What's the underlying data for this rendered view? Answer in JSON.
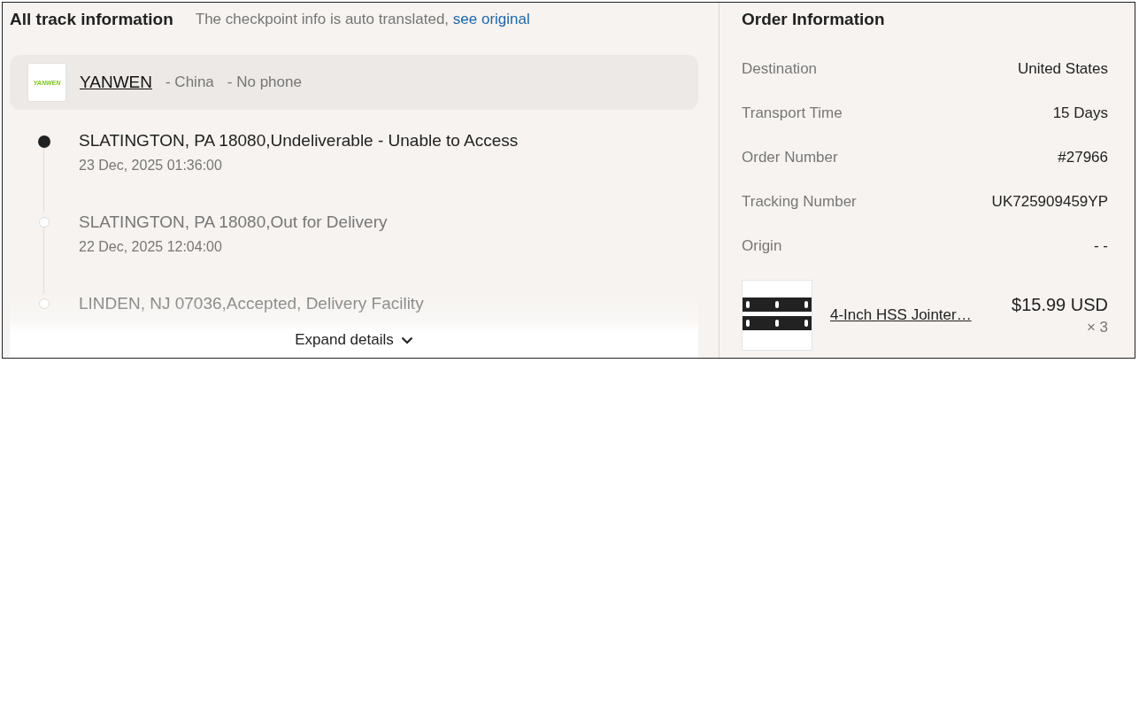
{
  "track": {
    "title": "All track information",
    "note": "The checkpoint info is auto translated,",
    "note_link": "see original",
    "carrier": {
      "name": "YANWEN",
      "logo_text": "YANWEN",
      "country": "- China",
      "phone": "- No phone"
    },
    "events": [
      {
        "text": "SLATINGTON, PA 18080,Undeliverable - Unable to Access",
        "time": "23 Dec, 2025 01:36:00",
        "current": true
      },
      {
        "text": "SLATINGTON, PA 18080,Out for Delivery",
        "time": "22 Dec, 2025 12:04:00",
        "current": false
      },
      {
        "text": "LINDEN, NJ 07036,Accepted, Delivery Facility",
        "current": false
      }
    ],
    "expand_label": "Expand details"
  },
  "order": {
    "title": "Order Information",
    "rows": [
      {
        "label": "Destination",
        "value": "United States"
      },
      {
        "label": "Transport Time",
        "value": "15 Days"
      },
      {
        "label": "Order Number",
        "value": "#27966"
      },
      {
        "label": "Tracking Number",
        "value": "UK725909459YP"
      },
      {
        "label": "Origin",
        "value": "- -"
      }
    ],
    "product": {
      "name": "4-Inch HSS Jointer…",
      "price": "$15.99 USD",
      "quantity": "× 3"
    }
  }
}
